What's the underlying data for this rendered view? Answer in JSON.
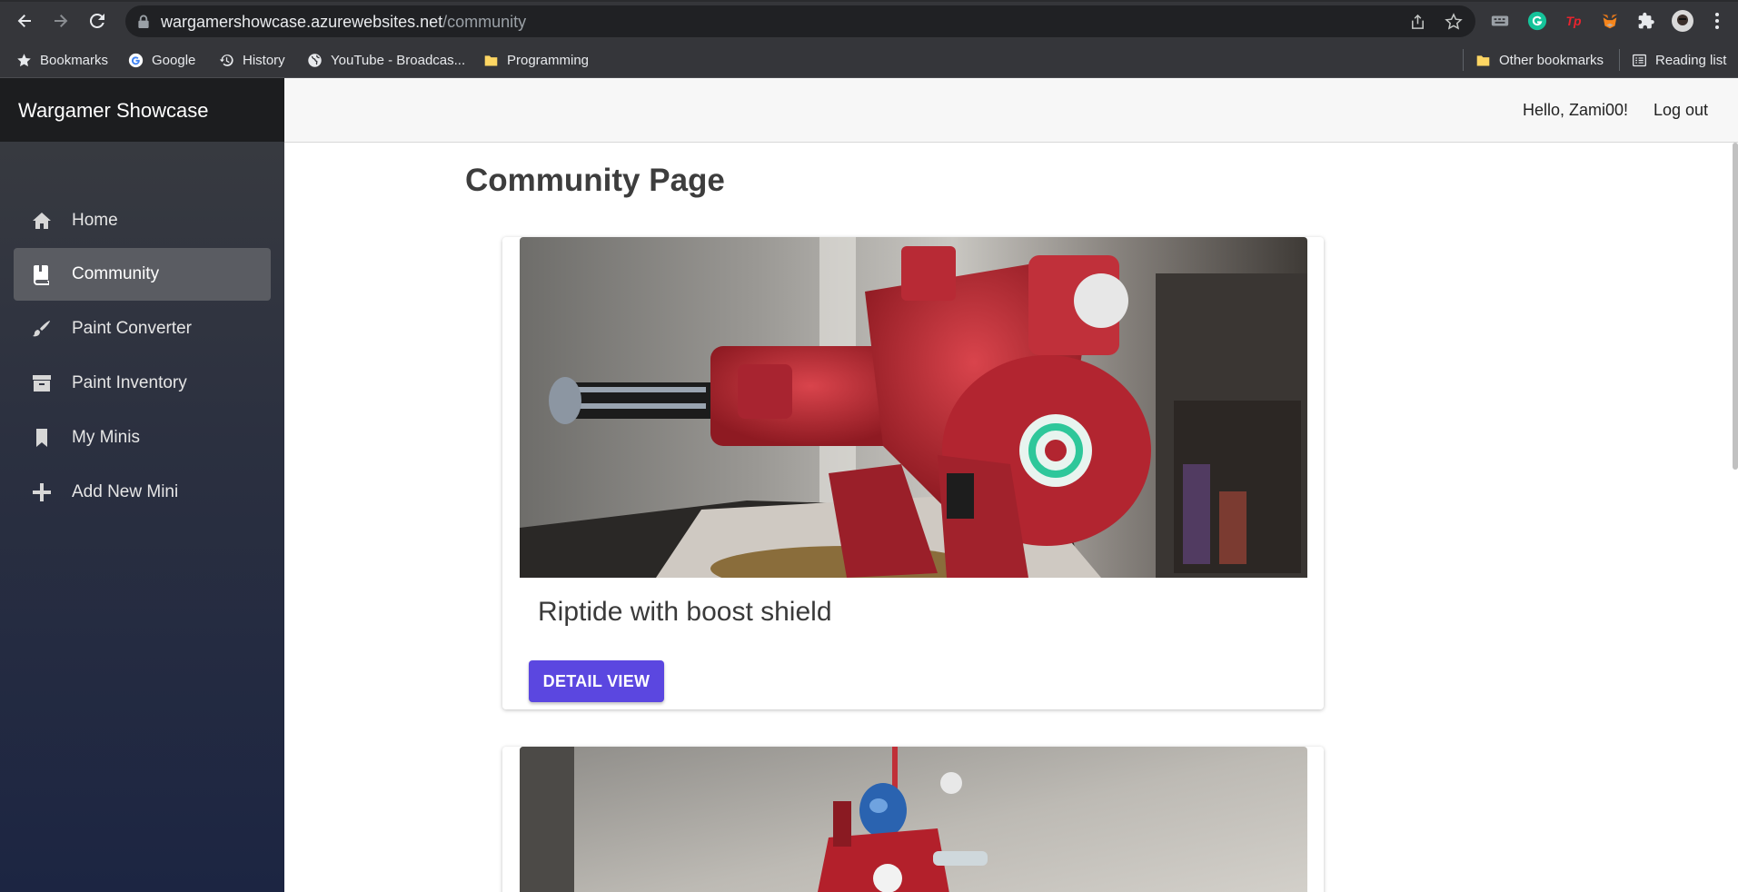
{
  "browser": {
    "url_host": "wargamershowcase.azurewebsites.net",
    "url_path": "/community",
    "bookmarks": [
      {
        "label": "Bookmarks",
        "icon": "star-icon"
      },
      {
        "label": "Google",
        "icon": "google-icon"
      },
      {
        "label": "History",
        "icon": "history-icon"
      },
      {
        "label": "YouTube - Broadcas...",
        "icon": "globe-icon"
      },
      {
        "label": "Programming",
        "icon": "folder-icon"
      }
    ],
    "other_bookmarks": "Other bookmarks",
    "reading_list": "Reading list",
    "extensions": [
      "keyboard-extension-icon",
      "grammarly-icon",
      "tp-extension-icon",
      "metamask-icon",
      "puzzle-icon",
      "profile-avatar"
    ]
  },
  "app": {
    "brand": "Wargamer Showcase",
    "nav": [
      {
        "label": "Home",
        "icon": "home-icon",
        "active": false
      },
      {
        "label": "Community",
        "icon": "book-icon",
        "active": true
      },
      {
        "label": "Paint Converter",
        "icon": "brush-icon",
        "active": false
      },
      {
        "label": "Paint Inventory",
        "icon": "archive-icon",
        "active": false
      },
      {
        "label": "My Minis",
        "icon": "bookmark-icon",
        "active": false
      },
      {
        "label": "Add New Mini",
        "icon": "plus-icon",
        "active": false
      }
    ],
    "greeting": "Hello, Zami00!",
    "logout": "Log out"
  },
  "page": {
    "title": "Community Page",
    "cards": [
      {
        "title": "Riptide with boost shield",
        "button": "DETAIL VIEW"
      },
      {
        "title": "",
        "button": ""
      }
    ]
  },
  "colors": {
    "accent_button": "#5b47e0",
    "sidebar_active": "#5a5c62",
    "miniature_red": "#b3202b"
  }
}
